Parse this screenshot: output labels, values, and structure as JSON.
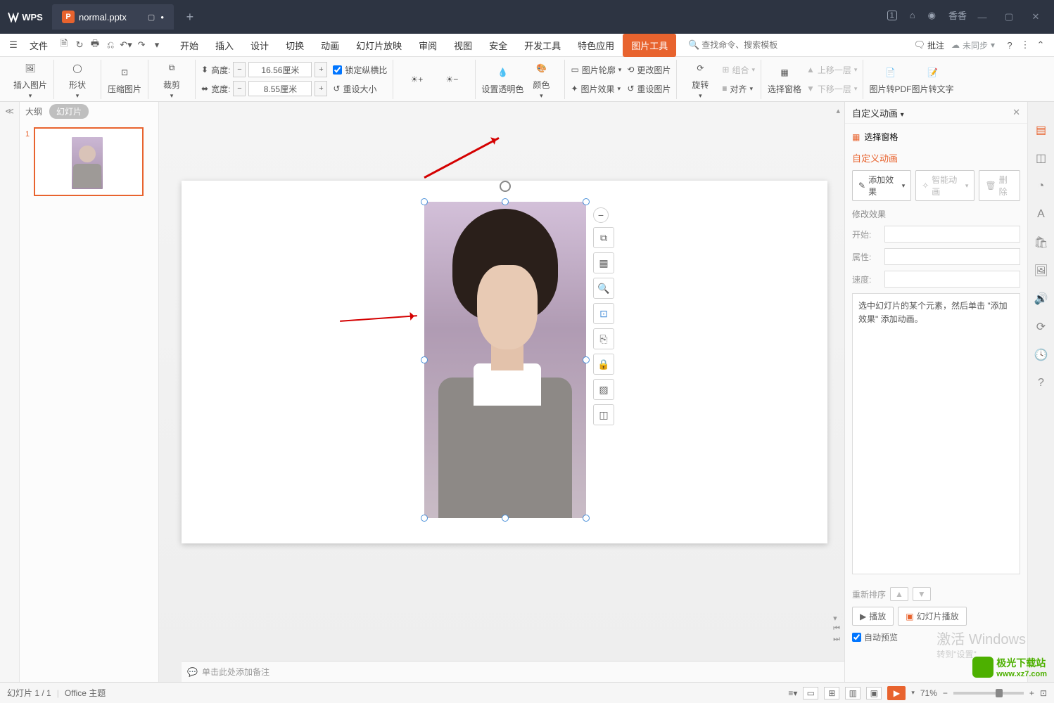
{
  "titlebar": {
    "app": "WPS",
    "tab_name": "normal.pptx",
    "user": "香香",
    "badge": "1"
  },
  "menubar": {
    "file": "文件",
    "items": [
      "开始",
      "插入",
      "设计",
      "切换",
      "动画",
      "幻灯片放映",
      "审阅",
      "视图",
      "安全",
      "开发工具",
      "特色应用"
    ],
    "picture_tools": "图片工具",
    "search_placeholder": "查找命令、搜索模板",
    "approve": "批注",
    "unsync": "未同步"
  },
  "ribbon": {
    "insert_pic": "插入图片",
    "shape": "形状",
    "compress": "压缩图片",
    "crop": "裁剪",
    "height_label": "高度:",
    "width_label": "宽度:",
    "height_value": "16.56厘米",
    "width_value": "8.55厘米",
    "lock_ratio": "锁定纵横比",
    "reset_size": "重设大小",
    "transparency": "设置透明色",
    "color": "颜色",
    "outline": "图片轮廓",
    "effect": "图片效果",
    "change_pic": "更改图片",
    "reset_pic": "重设图片",
    "rotate": "旋转",
    "group": "组合",
    "align": "对齐",
    "sel_pane": "选择窗格",
    "move_up": "上移一层",
    "move_down": "下移一层",
    "pic_to_pdf": "图片转PDF",
    "pic_to_text": "图片转文字"
  },
  "thumbs": {
    "outline": "大纲",
    "slides": "幻灯片",
    "num": "1"
  },
  "notes_placeholder": "单击此处添加备注",
  "panel": {
    "title": "自定义动画",
    "sel_pane": "选择窗格",
    "custom_anim": "自定义动画",
    "add_effect": "添加效果",
    "smart_anim": "智能动画",
    "delete": "删除",
    "modify": "修改效果",
    "start": "开始:",
    "property": "属性:",
    "speed": "速度:",
    "instruction": "选中幻灯片的某个元素，然后单击 \"添加效果\" 添加动画。",
    "reorder": "重新排序",
    "play": "播放",
    "slideshow": "幻灯片播放",
    "auto_preview": "自动预览",
    "activate": "激活 Windows",
    "activate_sub": "转到\"设置\""
  },
  "status": {
    "slide_pos": "幻灯片 1 / 1",
    "theme": "Office 主题",
    "zoom": "71%"
  },
  "watermark": {
    "site1": "极光下载站",
    "site2": "www.xz7.com"
  }
}
